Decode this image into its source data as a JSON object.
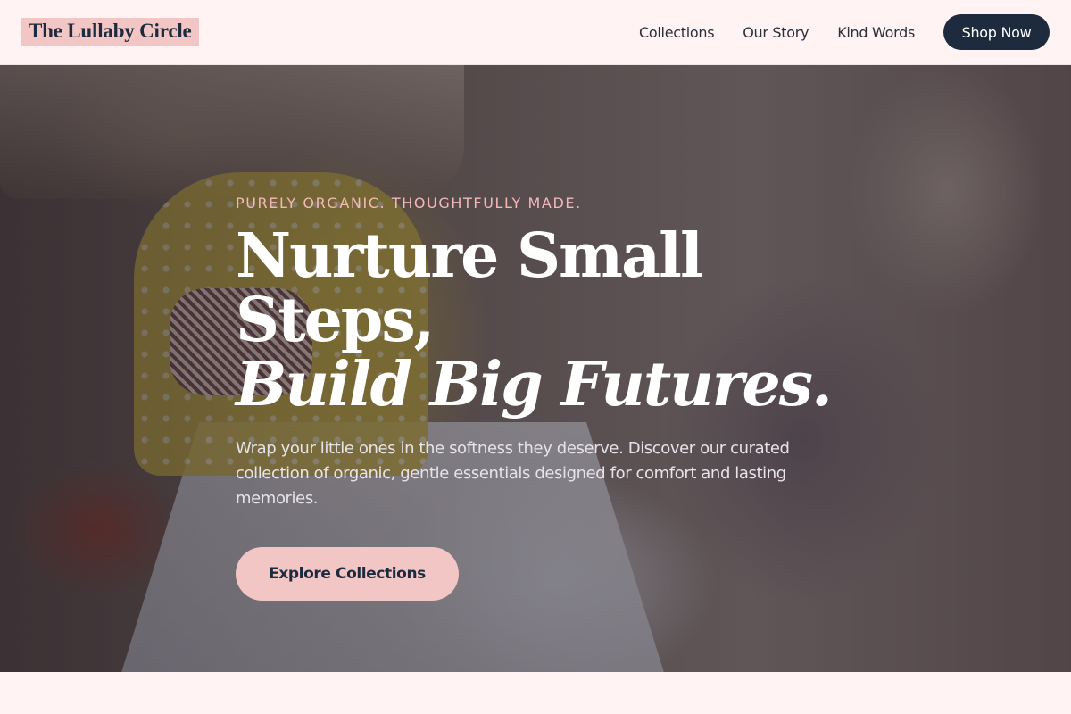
{
  "header": {
    "logo": "The Lullaby Circle",
    "nav": [
      "Collections",
      "Our Story",
      "Kind Words"
    ],
    "cta": "Shop Now"
  },
  "hero": {
    "eyebrow": "PURELY ORGANIC. THOUGHTFULLY MADE.",
    "headline_line1": "Nurture Small Steps,",
    "headline_line2": "Build Big Futures.",
    "subtext": "Wrap your little ones in the softness they deserve. Discover our curated collection of organic, gentle essentials designed for comfort and lasting memories.",
    "cta": "Explore Collections"
  },
  "colors": {
    "brand_dark": "#1e2a3d",
    "accent_pink": "#f3c6c6",
    "page_bg": "#fff4f3"
  }
}
